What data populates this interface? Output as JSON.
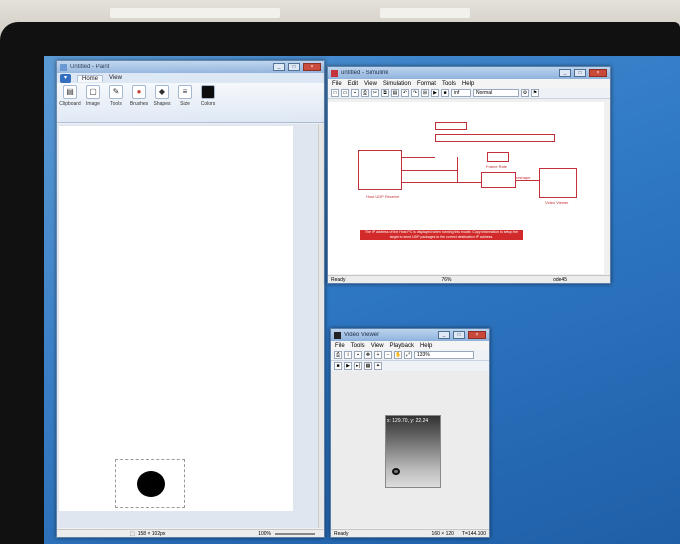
{
  "paint": {
    "title": "Untitled - Paint",
    "tabs": [
      "Home",
      "View"
    ],
    "ribbon_groups": [
      "Clipboard",
      "Image",
      "Tools",
      "Brushes",
      "Shapes",
      "Size",
      "Colors"
    ],
    "status_size": "158 × 102px",
    "zoom": "100%"
  },
  "simulink": {
    "title": "untitled - Simulink",
    "menu": [
      "File",
      "Edit",
      "View",
      "Simulation",
      "Format",
      "Tools",
      "Help"
    ],
    "stop_time": "inf",
    "sim_mode": "Normal",
    "status_ready": "Ready",
    "status_zoom": "76%",
    "status_solver": "ode45",
    "blocks": {
      "udp_receive": "Host UDP Receive",
      "video_viewer": "Video Viewer",
      "frame_rate": "Frame Rate",
      "reshape": "reshape"
    },
    "banner_text": "The IP address of the Host PC is displayed when running this model. Copy information to setup the target to send UDP packages to the correct destination IP address."
  },
  "video_viewer": {
    "title": "Video Viewer",
    "menu": [
      "File",
      "Tools",
      "View",
      "Playback",
      "Help"
    ],
    "zoom": "133%",
    "coords": "x: 129.70, y: 22.24",
    "status_ready": "Ready",
    "status_dims": "160 × 120",
    "status_time": "T=144.100"
  }
}
